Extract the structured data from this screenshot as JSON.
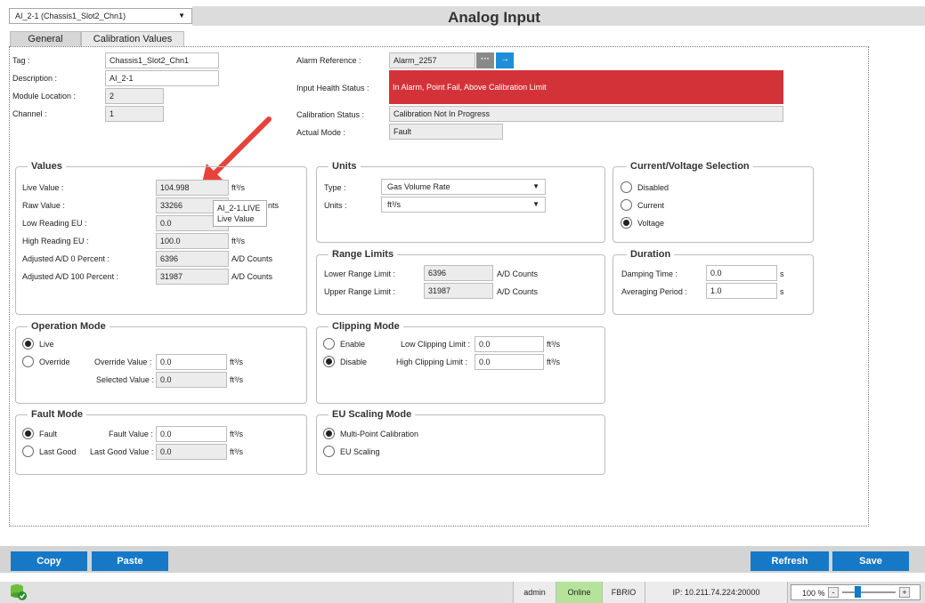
{
  "header": {
    "object_selector": "AI_2-1 (Chassis1_Slot2_Chn1)",
    "title": "Analog Input"
  },
  "tabs": [
    {
      "label": "General",
      "active": true
    },
    {
      "label": "Calibration Values",
      "active": false
    }
  ],
  "info": {
    "tag_label": "Tag :",
    "tag_value": "Chassis1_Slot2_Chn1",
    "description_label": "Description :",
    "description_value": "AI_2-1",
    "module_location_label": "Module Location :",
    "module_location_value": "2",
    "channel_label": "Channel :",
    "channel_value": "1",
    "alarm_reference_label": "Alarm Reference :",
    "alarm_reference_value": "Alarm_2257",
    "input_health_label": "Input Health Status :",
    "input_health_value": "In Alarm, Point Fail, Above Calibration Limit",
    "calibration_status_label": "Calibration Status :",
    "calibration_status_value": "Calibration Not In Progress",
    "actual_mode_label": "Actual Mode :",
    "actual_mode_value": "Fault",
    "alarm_color": "#d33338"
  },
  "values_group": {
    "title": "Values",
    "live_label": "Live Value :",
    "live_value": "104.998",
    "live_unit": "ft³/s",
    "raw_label": "Raw Value :",
    "raw_value": "33266",
    "raw_unit_partial": "nts",
    "low_label": "Low Reading EU :",
    "low_value": "0.0",
    "high_label": "High Reading EU :",
    "high_value": "100.0",
    "high_unit": "ft³/s",
    "adj0_label": "Adjusted A/D 0 Percent :",
    "adj0_value": "6396",
    "adj0_unit": "A/D Counts",
    "adj100_label": "Adjusted A/D 100 Percent :",
    "adj100_value": "31987",
    "adj100_unit": "A/D Counts",
    "tooltip_line1": "AI_2-1.LIVE",
    "tooltip_line2": "Live Value"
  },
  "units_group": {
    "title": "Units",
    "type_label": "Type :",
    "type_value": "Gas Volume Rate",
    "units_label": "Units :",
    "units_value": "ft³/s"
  },
  "range_group": {
    "title": "Range Limits",
    "lower_label": "Lower Range Limit :",
    "lower_value": "6396",
    "lower_unit": "A/D Counts",
    "upper_label": "Upper Range Limit :",
    "upper_value": "31987",
    "upper_unit": "A/D Counts"
  },
  "cv_group": {
    "title": "Current/Voltage Selection",
    "options": [
      "Disabled",
      "Current",
      "Voltage"
    ],
    "selected": "Voltage"
  },
  "duration_group": {
    "title": "Duration",
    "damping_label": "Damping Time :",
    "damping_value": "0.0",
    "damping_unit": "s",
    "averaging_label": "Averaging Period :",
    "averaging_value": "1.0",
    "averaging_unit": "s"
  },
  "operation_group": {
    "title": "Operation Mode",
    "live_option": "Live",
    "override_option": "Override",
    "selected": "Live",
    "override_value_label": "Override Value :",
    "override_value": "0.0",
    "override_unit": "ft³/s",
    "selected_value_label": "Selected Value :",
    "selected_value": "0.0",
    "selected_unit": "ft³/s"
  },
  "clipping_group": {
    "title": "Clipping Mode",
    "enable_option": "Enable",
    "disable_option": "Disable",
    "selected": "Disable",
    "low_label": "Low Clipping Limit :",
    "low_value": "0.0",
    "low_unit": "ft³/s",
    "high_label": "High Clipping Limit :",
    "high_value": "0.0",
    "high_unit": "ft³/s"
  },
  "fault_group": {
    "title": "Fault Mode",
    "fault_option": "Fault",
    "lastgood_option": "Last Good",
    "selected": "Fault",
    "fault_value_label": "Fault Value :",
    "fault_value": "0.0",
    "fault_unit": "ft³/s",
    "lastgood_value_label": "Last Good Value :",
    "lastgood_value": "0.0",
    "lastgood_unit": "ft³/s"
  },
  "eu_group": {
    "title": "EU Scaling Mode",
    "option1": "Multi-Point Calibration",
    "option2": "EU Scaling",
    "selected": "Multi-Point Calibration"
  },
  "actions": {
    "copy": "Copy",
    "paste": "Paste",
    "refresh": "Refresh",
    "save": "Save"
  },
  "status_bar": {
    "user": "admin",
    "connection": "Online",
    "device": "FBRIO",
    "ip": "IP: 10.211.74.224:20000",
    "zoom": "100 %",
    "zoom_minus": "-",
    "zoom_plus": "+",
    "db_icon": "database-check-icon"
  }
}
